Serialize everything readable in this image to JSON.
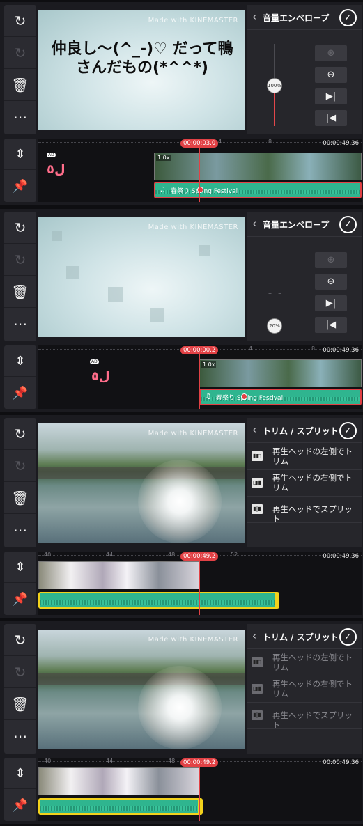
{
  "tools": {
    "undo_icon": "↻",
    "redo_icon": "↻",
    "delete_icon": "🗑",
    "more_icon": "⋯",
    "expand_icon": "⇕",
    "pin_icon": "📌"
  },
  "brand": {
    "watermark": "Made with KINEMASTER"
  },
  "screens": [
    {
      "subtitle": "仲良し〜(^_-)♡ だって鴨さんだもの(*^^*)",
      "panel_title": "音量エンベロープ",
      "volume_label": "100%",
      "volume_level": 1.0,
      "playhead_time": "00:00:03.0",
      "total_time": "00:00:49.36",
      "ruler": [
        "4",
        "8"
      ],
      "clip_speed": "1.0x",
      "audio_note": "♫",
      "audio_label": "春祭り",
      "audio_label2": "Spring Festival",
      "sticker_badge": "AD",
      "sticker": "ل٥"
    },
    {
      "panel_title": "音量エンベロープ",
      "volume_label": "20%",
      "volume_level": 0.2,
      "playhead_time": "00:00:00.2",
      "total_time": "00:00:49.36",
      "ruler": [
        "4",
        "8"
      ],
      "clip_speed": "1.0x",
      "audio_note": "♫",
      "audio_label": "春祭り",
      "audio_label2": "Spring Festival",
      "sticker_badge": "AD",
      "sticker": "ل٥"
    },
    {
      "panel_title": "トリム / スプリット",
      "trim_options": [
        "再生ヘッドの左側でトリム",
        "再生ヘッドの右側でトリム",
        "再生ヘッドでスプリット"
      ],
      "playhead_time": "00:00:49.2",
      "total_time": "00:00:49.36",
      "ruler": [
        "40",
        "44",
        "48",
        "52"
      ]
    },
    {
      "panel_title": "トリム / スプリット",
      "trim_options": [
        "再生ヘッドの左側でトリム",
        "再生ヘッドの右側でトリム",
        "再生ヘッドでスプリット"
      ],
      "playhead_time": "00:00:49.2",
      "total_time": "00:00:49.36",
      "ruler": [
        "40",
        "44",
        "48"
      ]
    }
  ],
  "envelope_buttons": {
    "add": "⊕",
    "remove": "⊖",
    "next": "▶|",
    "prev": "|◀"
  },
  "colors": {
    "accent_red": "#e24145",
    "audio_green": "#2fb58f",
    "trim_yellow": "#f2d21c"
  }
}
